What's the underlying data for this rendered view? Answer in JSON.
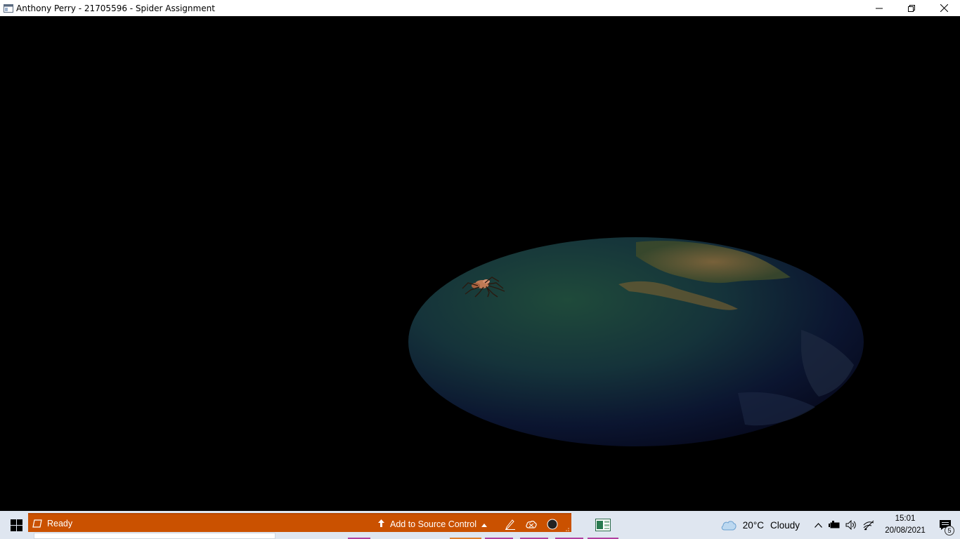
{
  "window": {
    "title": "Anthony Perry - 21705596 - Spider Assignment"
  },
  "scene": {
    "icons": [
      "globe",
      "spider"
    ]
  },
  "status_bar": {
    "state": "Ready",
    "source_control": "Add to Source Control",
    "accent": "#ca5100"
  },
  "taskbar": {
    "apps": [
      "chrome-icon",
      "vs-icon",
      "explorer-icon",
      "app-icon",
      "app-icon",
      "spreadsheet-icon"
    ]
  },
  "tray": {
    "temperature": "20°C",
    "condition": "Cloudy",
    "time": "15:01",
    "date": "20/08/2021",
    "notification_count": "5"
  }
}
